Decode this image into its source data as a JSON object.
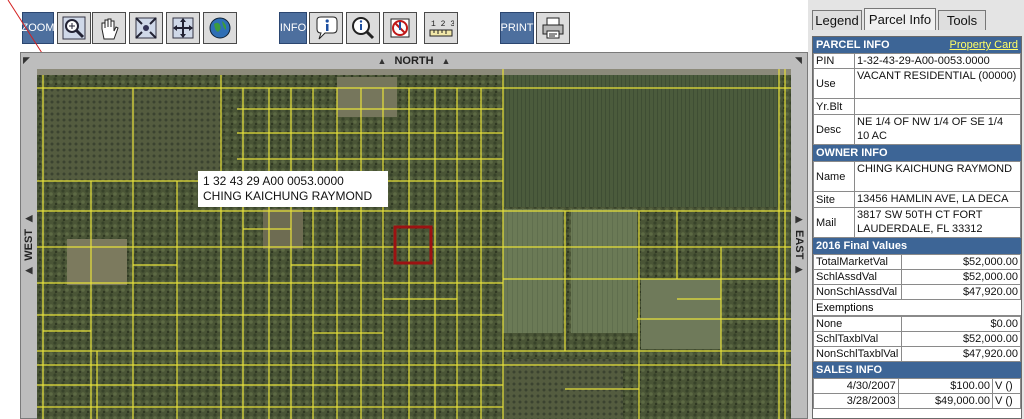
{
  "toolbar": {
    "zoom_label": "ZOOM",
    "info_label": "INFO",
    "print_label": "PRINT",
    "icons": [
      "zoom-in-icon",
      "pan-hand-icon",
      "zoom-extent-icon",
      "full-extent-icon",
      "globe-icon",
      "identify-icon",
      "query-icon",
      "clear-selection-icon",
      "measure-icon",
      "printer-icon"
    ]
  },
  "map": {
    "north": "NORTH",
    "west": "WEST",
    "east": "EAST",
    "label_pin": "1 32 43 29 A00 0053.0000",
    "label_owner": "CHING KAICHUNG RAYMOND",
    "colors": {
      "parcel_line": "#e8e23a",
      "selected_parcel": "#9c1212",
      "aerial_dark": "#4f5a3a"
    }
  },
  "tabs": {
    "legend": "Legend",
    "parcel_info": "Parcel Info",
    "tools": "Tools"
  },
  "parcel_info": {
    "heading": "PARCEL INFO",
    "property_card_link": "Property Card",
    "rows": [
      {
        "label": "PIN",
        "value": "1-32-43-29-A00-0053.0000"
      },
      {
        "label": "Use",
        "value": "VACANT RESIDENTIAL (00000)"
      },
      {
        "label": "Yr.Blt",
        "value": ""
      },
      {
        "label": "Desc",
        "value": "NE 1/4 OF NW 1/4 OF SE 1/4 10 AC"
      }
    ]
  },
  "owner_info": {
    "heading": "OWNER INFO",
    "rows": [
      {
        "label": "Name",
        "value": "CHING KAICHUNG RAYMOND"
      },
      {
        "label": "Site",
        "value": "13456 HAMLIN AVE, LA DECA"
      },
      {
        "label": "Mail",
        "value": "3817 SW 50TH CT FORT LAUDERDALE, FL 33312"
      }
    ]
  },
  "final_values": {
    "heading": "2016 Final Values",
    "rows": [
      {
        "label": "TotalMarketVal",
        "value": "$52,000.00"
      },
      {
        "label": "SchlAssdVal",
        "value": "$52,000.00"
      },
      {
        "label": "NonSchlAssdVal",
        "value": "$47,920.00"
      }
    ],
    "exemptions_label": "Exemptions",
    "exemption_rows": [
      {
        "label": "None",
        "value": "$0.00"
      },
      {
        "label": "SchlTaxblVal",
        "value": "$52,000.00"
      },
      {
        "label": "NonSchlTaxblVal",
        "value": "$47,920.00"
      }
    ]
  },
  "sales_info": {
    "heading": "SALES INFO",
    "rows": [
      {
        "date": "4/30/2007",
        "price": "$100.00",
        "code": "V ()"
      },
      {
        "date": "3/28/2003",
        "price": "$49,000.00",
        "code": "V ()"
      }
    ]
  }
}
